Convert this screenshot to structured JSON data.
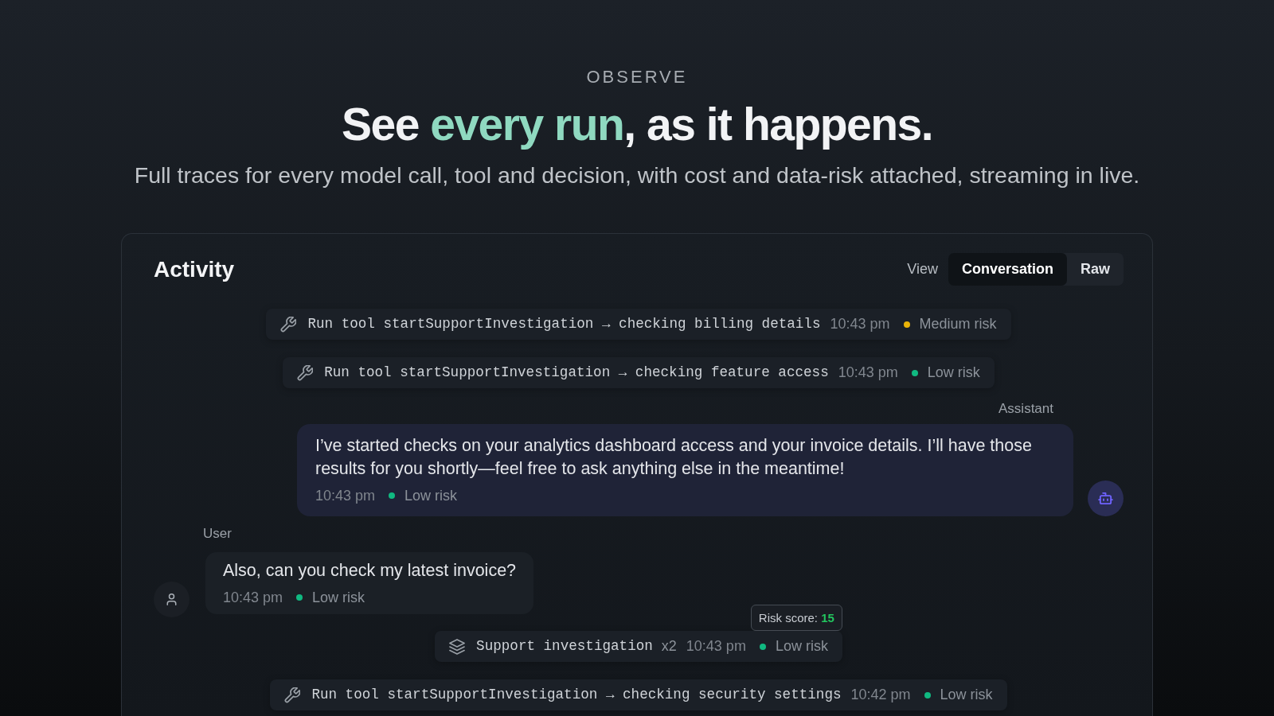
{
  "hero": {
    "eyebrow": "OBSERVE",
    "headline": {
      "before": "See ",
      "highlight": "every run",
      "after": ", as it happens."
    },
    "subtitle": "Full traces for every model call, tool and decision, with cost and data-risk attached, streaming in live."
  },
  "panel": {
    "title": "Activity",
    "view_label": "View",
    "view_options": [
      {
        "label": "Conversation",
        "selected": true
      },
      {
        "label": "Raw",
        "selected": false
      }
    ]
  },
  "feed": [
    {
      "kind": "tool",
      "text": "Run tool startSupportInvestigation → checking billing details",
      "time": "10:43 pm",
      "risk": {
        "label": "Medium risk",
        "color": "#eab308"
      }
    },
    {
      "kind": "tool",
      "text": "Run tool startSupportInvestigation → checking feature access",
      "time": "10:43 pm",
      "risk": {
        "label": "Low risk",
        "color": "#10b981"
      }
    },
    {
      "kind": "assistant_message",
      "sender": "Assistant",
      "text": "I’ve started checks on your analytics dashboard access and your invoice details. I’ll have those results for you shortly—feel free to ask anything else in the meantime!",
      "time": "10:43 pm",
      "risk": {
        "label": "Low risk",
        "color": "#10b981"
      }
    },
    {
      "kind": "user_message",
      "sender": "User",
      "text": "Also, can you check my latest invoice?",
      "time": "10:43 pm",
      "risk": {
        "label": "Low risk",
        "color": "#10b981"
      }
    },
    {
      "kind": "group",
      "text": "Support investigation",
      "count": "x2",
      "time": "10:43 pm",
      "risk": {
        "label": "Low risk",
        "color": "#10b981"
      },
      "tooltip": {
        "label": "Risk score:",
        "value": "15"
      }
    },
    {
      "kind": "tool",
      "text": "Run tool startSupportInvestigation → checking security settings",
      "time": "10:42 pm",
      "risk": {
        "label": "Low risk",
        "color": "#10b981"
      }
    }
  ]
}
